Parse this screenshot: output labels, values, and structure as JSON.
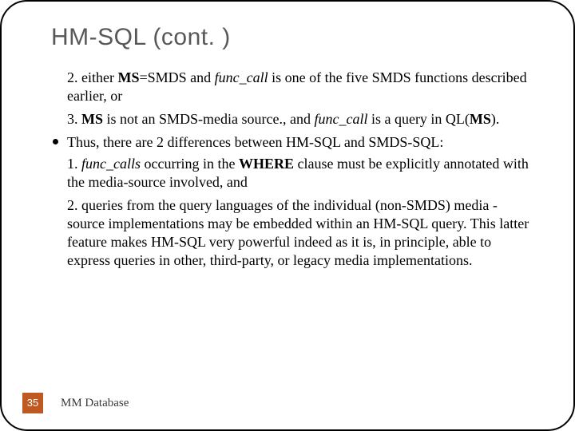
{
  "title": "HM-SQL (cont. )",
  "body": {
    "p1_a": "2. either ",
    "p1_b": "MS",
    "p1_c": "=SMDS and ",
    "p1_d": "func_call",
    "p1_e": " is one of the five SMDS functions described earlier, or",
    "p2_a": "3. ",
    "p2_b": "MS",
    "p2_c": " is not an SMDS-media source., and ",
    "p2_d": "func_call",
    "p2_e": " is a query in QL(",
    "p2_f": "MS",
    "p2_g": ").",
    "bul": "Thus, there are 2 differences between HM-SQL and SMDS-SQL:",
    "p3_a": "1. ",
    "p3_b": "func_calls",
    "p3_c": " occurring in the ",
    "p3_d": "WHERE",
    "p3_e": " clause must be explicitly annotated with the media-source involved, and",
    "p4": "2. queries from the query languages of the individual (non-SMDS) media -source implementations may be embedded within an HM-SQL query. This latter feature makes HM-SQL very powerful indeed as it is, in principle, able to express queries in other, third-party, or legacy media implementations."
  },
  "footer": {
    "page": "35",
    "label": "MM Database"
  }
}
